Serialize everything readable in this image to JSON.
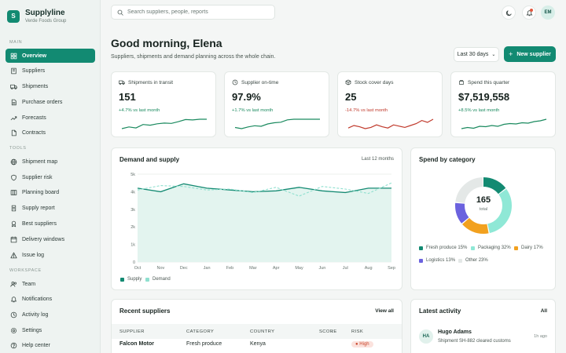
{
  "brand": {
    "initial": "S",
    "name": "Supplyline",
    "org": "Verde Foods Group"
  },
  "sidebar": {
    "sections": [
      {
        "label": "MAIN",
        "items": [
          {
            "label": "Overview",
            "icon": "grid-icon",
            "active": true
          },
          {
            "label": "Suppliers",
            "icon": "building-icon"
          },
          {
            "label": "Shipments",
            "icon": "truck-icon"
          },
          {
            "label": "Purchase orders",
            "icon": "document-icon"
          },
          {
            "label": "Forecasts",
            "icon": "trend-icon"
          },
          {
            "label": "Contracts",
            "icon": "file-icon"
          }
        ]
      },
      {
        "label": "TOOLS",
        "items": [
          {
            "label": "Shipment map",
            "icon": "globe-icon"
          },
          {
            "label": "Supplier risk",
            "icon": "shield-icon"
          },
          {
            "label": "Planning board",
            "icon": "board-icon"
          },
          {
            "label": "Supply report",
            "icon": "report-icon"
          },
          {
            "label": "Best suppliers",
            "icon": "award-icon"
          },
          {
            "label": "Delivery windows",
            "icon": "calendar-icon"
          },
          {
            "label": "Issue log",
            "icon": "alert-icon"
          }
        ]
      },
      {
        "label": "WORKSPACE",
        "items": [
          {
            "label": "Team",
            "icon": "users-icon"
          },
          {
            "label": "Notifications",
            "icon": "bell-icon"
          },
          {
            "label": "Activity log",
            "icon": "clock-icon"
          },
          {
            "label": "Settings",
            "icon": "gear-icon"
          },
          {
            "label": "Help center",
            "icon": "help-icon"
          }
        ]
      }
    ]
  },
  "topbar": {
    "search_placeholder": "Search suppliers, people, reports",
    "avatar_initials": "EM"
  },
  "header": {
    "greeting": "Good morning, Elena",
    "subtitle": "Suppliers, shipments and demand planning across the whole chain.",
    "range": "Last 30 days",
    "new_supplier": "New supplier"
  },
  "kpis": [
    {
      "label": "Shipments in transit",
      "value": "151",
      "delta": "+4.7% vs last month",
      "trend": "up",
      "color": "#1b8a5f",
      "spark": [
        3,
        3.5,
        3.2,
        4.2,
        4,
        4.4,
        4.6,
        4.5,
        5,
        5.6,
        5.5,
        5.7,
        5.7
      ]
    },
    {
      "label": "Supplier on-time",
      "value": "97.9%",
      "delta": "+1.7% vs last month",
      "trend": "up",
      "color": "#1b8a5f",
      "spark": [
        3,
        2.6,
        3.2,
        3.6,
        3.4,
        4.2,
        4.6,
        4.8,
        5.6,
        5.8,
        5.8,
        5.8,
        5.8,
        5.8
      ]
    },
    {
      "label": "Stock cover days",
      "value": "25",
      "delta": "-14.7% vs last month",
      "trend": "down",
      "color": "#c0392b",
      "spark": [
        3.4,
        3.8,
        3.6,
        3.3,
        3.5,
        3.9,
        3.6,
        3.4,
        3.9,
        3.7,
        3.5,
        3.8,
        4.1,
        4.6,
        4.3,
        4.8
      ]
    },
    {
      "label": "Spend this quarter",
      "value": "$7,519,558",
      "delta": "+8.5% vs last month",
      "trend": "up",
      "color": "#1b8a5f",
      "spark": [
        3,
        3.3,
        3.1,
        3.6,
        3.5,
        3.8,
        3.6,
        4.1,
        4.3,
        4.2,
        4.5,
        4.4,
        4.8,
        5,
        5.4
      ]
    }
  ],
  "demand_card": {
    "title": "Demand and supply",
    "range": "Last 12 months"
  },
  "chart_data": {
    "type": "line",
    "title": "Demand and supply",
    "categories": [
      "Oct",
      "Nov",
      "Dec",
      "Jan",
      "Feb",
      "Mar",
      "Apr",
      "May",
      "Jun",
      "Jul",
      "Aug",
      "Sep"
    ],
    "yticks": [
      "0",
      "1k",
      "2k",
      "3k",
      "4k",
      "5k"
    ],
    "ylim": [
      0,
      5000
    ],
    "series": [
      {
        "name": "Supply",
        "color": "#138a72",
        "values": [
          4200,
          4000,
          4450,
          4200,
          4100,
          4000,
          4050,
          4250,
          4050,
          3950,
          4200,
          4200
        ]
      },
      {
        "name": "Demand",
        "color": "#8fe0cf",
        "values": [
          4100,
          4350,
          4300,
          4100,
          4150,
          3950,
          4250,
          3750,
          4300,
          4150,
          3900,
          4500
        ]
      }
    ],
    "grid": true,
    "legend": "bottom-left"
  },
  "category_card": {
    "title": "Spend by category",
    "total": "165",
    "total_label": "total",
    "slices": [
      {
        "label": "Fresh produce",
        "pct": 15,
        "color": "#138a72"
      },
      {
        "label": "Packaging",
        "pct": 32,
        "color": "#8fe8d6"
      },
      {
        "label": "Dairy",
        "pct": 17,
        "color": "#f2a11f"
      },
      {
        "label": "Logistics",
        "pct": 13,
        "color": "#6b62de"
      },
      {
        "label": "Other",
        "pct": 23,
        "color": "#e4e8e7"
      }
    ]
  },
  "recent_suppliers": {
    "title": "Recent suppliers",
    "link": "View all",
    "columns": [
      "SUPPLIER",
      "CATEGORY",
      "COUNTRY",
      "SCORE",
      "RISK"
    ],
    "rows": [
      {
        "supplier": "Falcon Motor",
        "category": "Fresh produce",
        "country": "Kenya",
        "score": "",
        "risk": "High"
      }
    ]
  },
  "activity": {
    "title": "Latest activity",
    "filter": "All",
    "items": [
      {
        "initials": "HA",
        "name": "Hugo Adams",
        "text": "Shipment SH-882 cleared customs",
        "time": "1h ago"
      }
    ]
  }
}
